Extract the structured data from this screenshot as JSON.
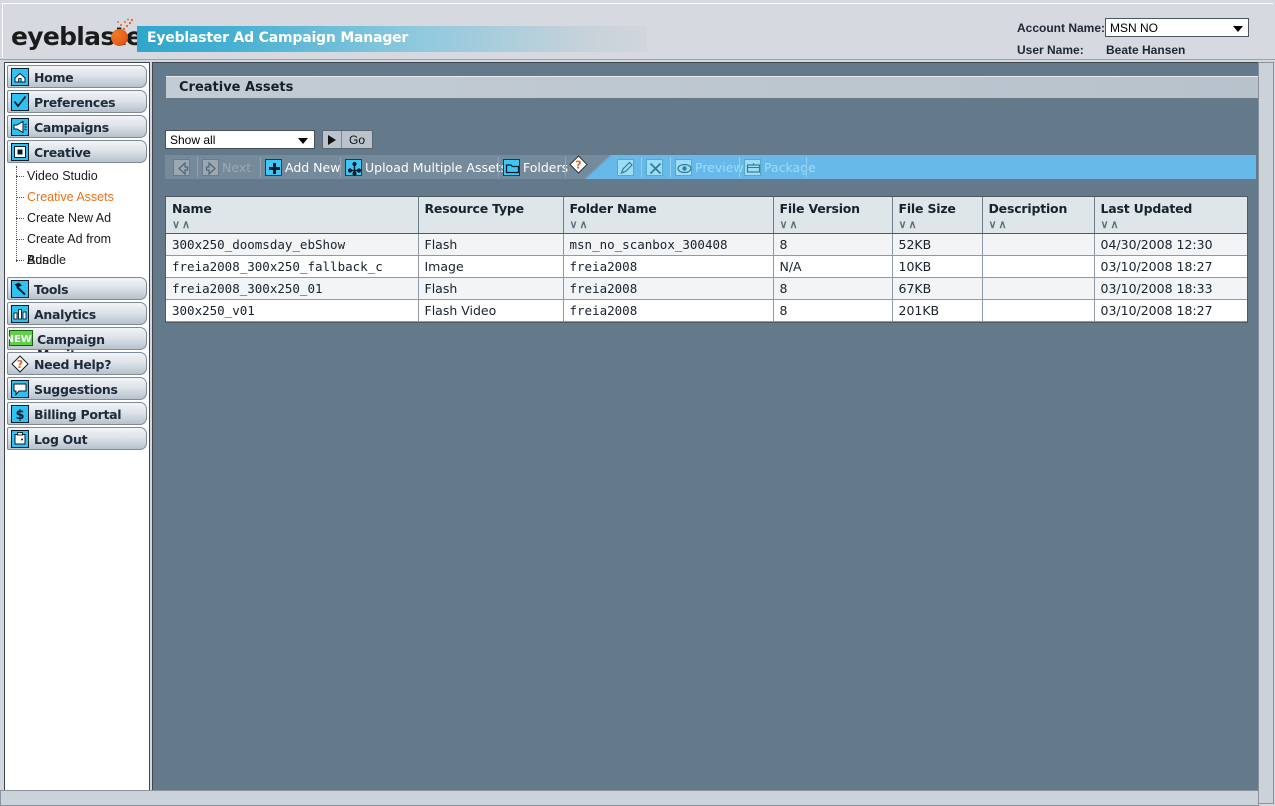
{
  "header": {
    "logo_text": "eyeblaster",
    "logo_icon": "bomb-icon",
    "app_title": "Eyeblaster Ad Campaign Manager",
    "account_label": "Account Name:",
    "account_value": "MSN NO",
    "user_label": "User Name:",
    "user_value": "Beate Hansen",
    "accent_cyan": "#2fa6cc"
  },
  "sidebar": {
    "items": [
      {
        "label": "Home",
        "icon": "home-icon"
      },
      {
        "label": "Preferences",
        "icon": "checkmark-icon"
      },
      {
        "label": "Campaigns",
        "icon": "megaphone-icon"
      },
      {
        "label": "Creative",
        "icon": "square-dot-icon"
      }
    ],
    "subitems": [
      {
        "label": "Video Studio",
        "active": false
      },
      {
        "label": "Creative Assets",
        "active": true
      },
      {
        "label": "Create New Ad",
        "active": false
      },
      {
        "label": "Create Ad from Bundle",
        "active": false
      },
      {
        "label": "Ads",
        "active": false
      }
    ],
    "items_lower": [
      {
        "label": "Tools",
        "icon": "hammer-icon"
      },
      {
        "label": "Analytics",
        "icon": "bar-chart-icon"
      },
      {
        "label": "Campaign Monitor",
        "icon": "new-badge-icon"
      },
      {
        "label": "Need Help?",
        "icon": "question-diamond-icon"
      },
      {
        "label": "Suggestions",
        "icon": "speech-bubble-icon"
      },
      {
        "label": "Billing Portal",
        "icon": "dollar-icon"
      },
      {
        "label": "Log Out",
        "icon": "door-icon"
      }
    ],
    "active_color": "#e8731a"
  },
  "main": {
    "page_title": "Creative Assets",
    "filter": {
      "value": "Show all",
      "go_label": "Go",
      "go_icon": "play-triangle-icon"
    },
    "toolbar": {
      "prev_icon": "arrow-left-icon",
      "next_icon": "arrow-right-icon",
      "next_label": "Next",
      "add_new_label": "Add New",
      "add_new_icon": "plus-icon",
      "upload_label": "Upload Multiple Assets",
      "upload_icon": "upload-multi-icon",
      "folders_label": "Folders",
      "folders_icon": "folder-icon",
      "help_icon": "question-diamond-icon",
      "edit_icon": "pencil-icon",
      "delete_icon": "x-delete-icon",
      "preview_label": "Preview",
      "preview_icon": "eye-icon",
      "package_label": "Package",
      "package_icon": "package-icon"
    },
    "table": {
      "columns": [
        {
          "label": "Name",
          "sortable": true
        },
        {
          "label": "Resource Type",
          "sortable": false
        },
        {
          "label": "Folder Name",
          "sortable": true
        },
        {
          "label": "File Version",
          "sortable": true
        },
        {
          "label": "File Size",
          "sortable": true
        },
        {
          "label": "Description",
          "sortable": true
        },
        {
          "label": "Last Updated",
          "sortable": true
        }
      ],
      "sort_down_glyph": "∨",
      "sort_up_glyph": "∧",
      "rows": [
        {
          "name": "300x250_doomsday_ebShow",
          "resource_type": "Flash",
          "folder_name": "msn_no_scanbox_300408",
          "file_version": "8",
          "file_size": "52KB",
          "description": "",
          "last_updated": "04/30/2008 12:30"
        },
        {
          "name": "freia2008_300x250_fallback_c",
          "resource_type": "Image",
          "folder_name": "freia2008",
          "file_version": "N/A",
          "file_size": "10KB",
          "description": "",
          "last_updated": "03/10/2008 18:27"
        },
        {
          "name": "freia2008_300x250_01",
          "resource_type": "Flash",
          "folder_name": "freia2008",
          "file_version": "8",
          "file_size": "67KB",
          "description": "",
          "last_updated": "03/10/2008 18:33"
        },
        {
          "name": "300x250_v01",
          "resource_type": "Flash Video",
          "folder_name": "freia2008",
          "file_version": "8",
          "file_size": "201KB",
          "description": "",
          "last_updated": "03/10/2008 18:27"
        }
      ]
    }
  }
}
